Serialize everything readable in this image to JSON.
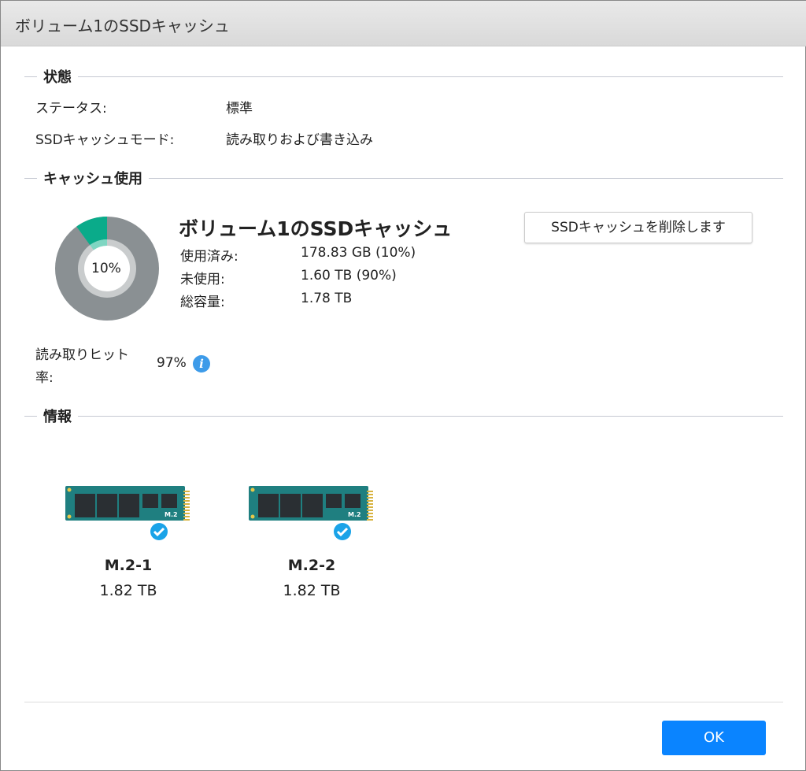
{
  "title": "ボリューム1のSSDキャッシュ",
  "status_section": {
    "heading": "状態",
    "rows": [
      {
        "label": "ステータス:",
        "value": "標準"
      },
      {
        "label": "SSDキャッシュモード:",
        "value": "読み取りおよび書き込み"
      }
    ]
  },
  "usage_section": {
    "heading": "キャッシュ使用",
    "name": "ボリューム1のSSDキャッシュ",
    "donut_label": "10%",
    "used_fraction": 0.1,
    "rows": [
      {
        "label": "使用済み:",
        "value": "178.83 GB (10%)"
      },
      {
        "label": "未使用:",
        "value": "1.60 TB (90%)"
      },
      {
        "label": "総容量:",
        "value": "1.78 TB"
      }
    ],
    "delete_button": "SSDキャッシュを削除します",
    "hit_rate_label_1": "読み取りヒット",
    "hit_rate_label_2": "率:",
    "hit_rate": "97%",
    "info_icon": "i",
    "colors": {
      "used": "#0aab8a",
      "free": "#8a9093"
    }
  },
  "info_section": {
    "heading": "情報",
    "drives": [
      {
        "name": "M.2-1",
        "size": "1.82 TB"
      },
      {
        "name": "M.2-2",
        "size": "1.82 TB"
      }
    ]
  },
  "ok_button": "OK"
}
